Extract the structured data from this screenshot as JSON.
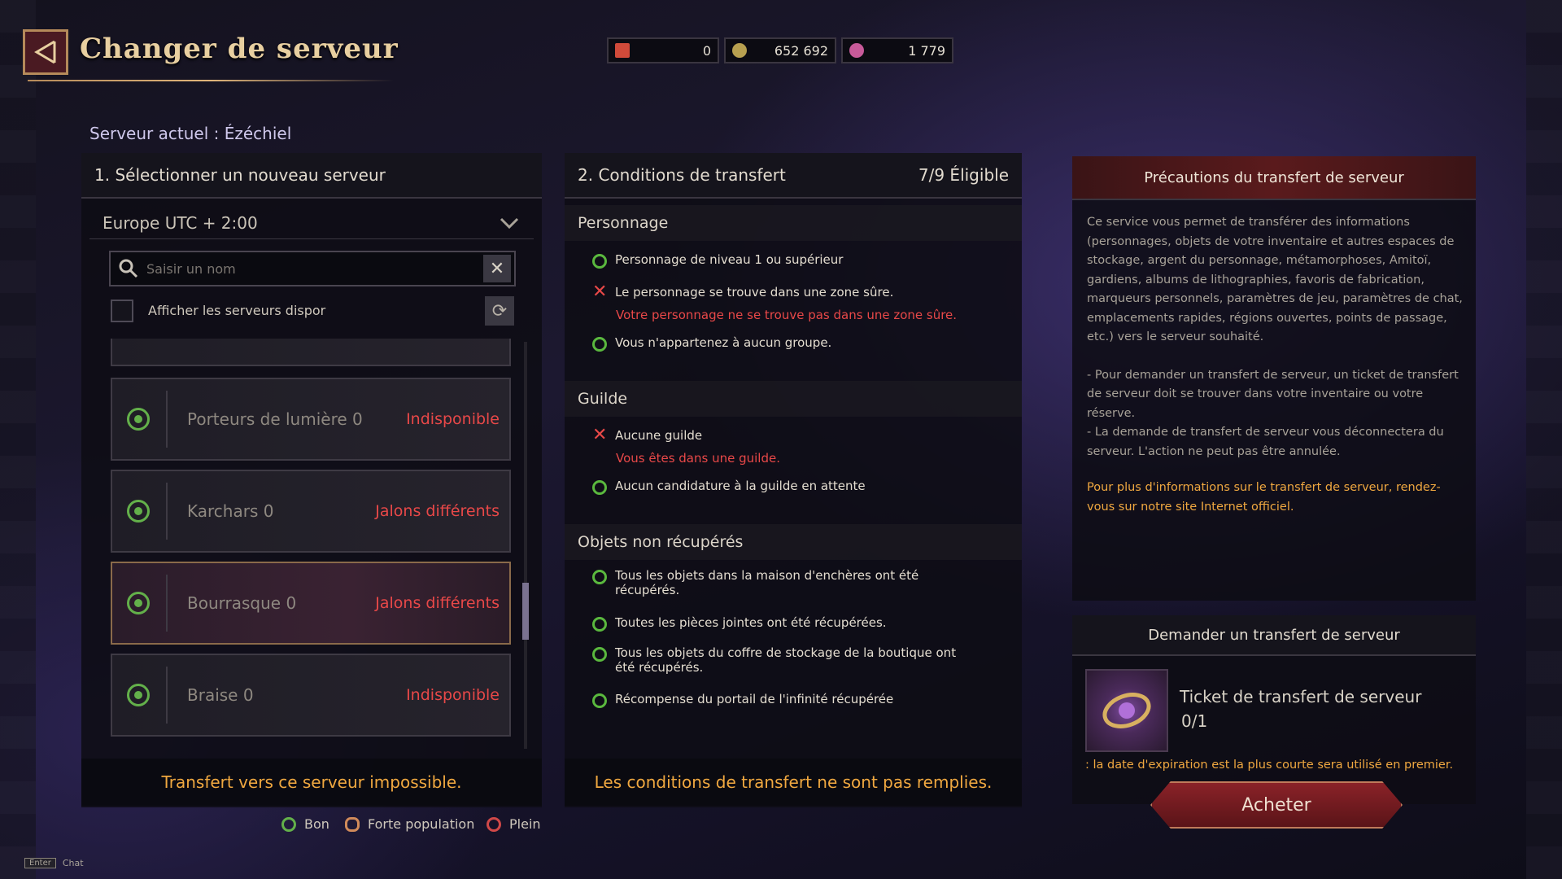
{
  "header": {
    "title": "Changer de serveur"
  },
  "currencies": [
    {
      "icon": "ticket-currency-icon",
      "value": "0",
      "color": "#d04a3a"
    },
    {
      "icon": "silver-coin-icon",
      "value": "652 692",
      "color": "#b8a050"
    },
    {
      "icon": "pheon-gem-icon",
      "value": "1 779",
      "color": "#c85a9a"
    }
  ],
  "current_server": {
    "label": "Serveur actuel :",
    "value": "Ézéchiel"
  },
  "select_panel": {
    "title": "1. Sélectionner un nouveau serveur",
    "region": "Europe UTC + 2:00",
    "search_placeholder": "Saisir un nom",
    "available_filter": "Afficher les serveurs dispor",
    "servers": [
      {
        "name": "Porteurs de lumière",
        "count": "0",
        "status": "Indisponible"
      },
      {
        "name": "Karchars",
        "count": "0",
        "status": "Jalons différents"
      },
      {
        "name": "Bourrasque",
        "count": "0",
        "status": "Jalons différents"
      },
      {
        "name": "Braise",
        "count": "0",
        "status": "Indisponible"
      }
    ],
    "footer": "Transfert vers ce serveur impossible."
  },
  "conditions_panel": {
    "title": "2. Conditions de transfert",
    "eligibility": "7/9 Éligible",
    "sections": {
      "personnage": "Personnage",
      "guilde": "Guilde",
      "objets": "Objets non récupérés"
    },
    "items": {
      "level": "Personnage de niveau 1 ou supérieur",
      "safe_zone": "Le personnage se trouve dans une zone sûre.",
      "safe_zone_error": "Votre personnage ne se trouve pas dans une zone sûre.",
      "no_group": "Vous n'appartenez à aucun groupe.",
      "no_guild": "Aucune guilde",
      "no_guild_error": "Vous êtes dans une guilde.",
      "no_application": "Aucun candidature à la guilde en attente",
      "auction": "Tous les objets dans la maison d'enchères ont été récupérés.",
      "attachments": "Toutes les pièces jointes ont été récupérées.",
      "shop_storage": "Tous les objets du coffre de stockage de la boutique ont été récupérés.",
      "infinity_portal": "Récompense du portail de l'infinité récupérée"
    },
    "footer": "Les conditions de transfert ne sont pas remplies."
  },
  "legend": [
    {
      "label": "Bon",
      "icon": "good-status-icon"
    },
    {
      "label": "Forte population",
      "icon": "high-population-icon"
    },
    {
      "label": "Plein",
      "icon": "full-status-icon"
    }
  ],
  "precautions": {
    "title": "Précautions du transfert de serveur",
    "paragraph1": "Ce service vous permet de transférer des informations (personnages, objets de votre inventaire et autres espaces de stockage, argent du personnage, métamorphoses, Amitoï, gardiens, albums de lithographies, favoris de fabrication, marqueurs personnels, paramètres de jeu, paramètres de chat, emplacements rapides, régions ouvertes, points de passage, etc.) vers le serveur souhaité.",
    "paragraph2": "- Pour demander un transfert de serveur, un ticket de transfert de serveur doit se trouver dans votre inventaire ou votre réserve.",
    "paragraph3": "- La demande de transfert de serveur vous déconnectera du serveur. L'action ne peut pas être annulée.",
    "link": "Pour plus d'informations sur le transfert de serveur, rendez-vous sur notre site Internet officiel."
  },
  "request": {
    "title": "Demander un transfert de serveur",
    "ticket_name": "Ticket de transfert de serveur",
    "ticket_count": "0/1",
    "expiry_note": ": la date d'expiration est la plus courte sera utilisé en premier.",
    "buy_label": "Acheter"
  },
  "chat_hint": {
    "key": "Enter",
    "label": "Chat"
  }
}
